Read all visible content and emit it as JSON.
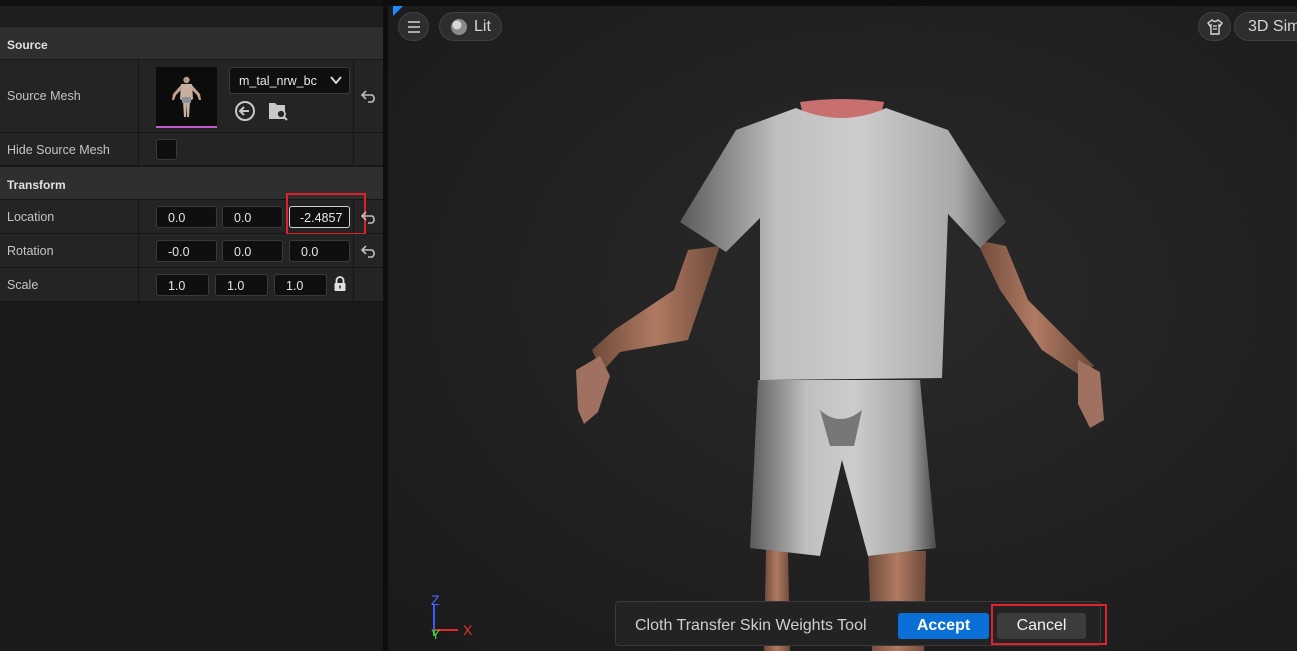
{
  "details": {
    "source_section": "Source",
    "source_mesh_label": "Source Mesh",
    "source_mesh_value": "m_tal_nrw_bc",
    "hide_source_mesh_label": "Hide Source Mesh",
    "transform_section": "Transform",
    "location_label": "Location",
    "location": [
      "0.0",
      "0.0",
      "-2.4857"
    ],
    "rotation_label": "Rotation",
    "rotation": [
      "-0.0",
      "0.0",
      "0.0"
    ],
    "scale_label": "Scale",
    "scale": [
      "1.0",
      "1.0",
      "1.0"
    ]
  },
  "viewport": {
    "lit_label": "Lit",
    "sim_label": "3D Sim",
    "axes": {
      "z": "Z",
      "y": "Y",
      "x": "X"
    },
    "tool": {
      "name": "Cloth Transfer Skin Weights Tool",
      "accept_label": "Accept",
      "cancel_label": "Cancel"
    }
  },
  "colors": {
    "accent": "#0a6fd6",
    "highlight": "#e0202a",
    "axis_x": "#e02a2a",
    "axis_y": "#2ad02a",
    "axis_z": "#3a5aff"
  }
}
